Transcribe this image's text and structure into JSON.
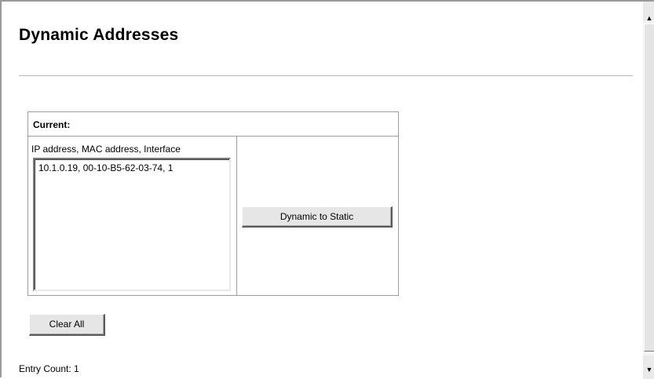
{
  "page": {
    "title": "Dynamic Addresses"
  },
  "current": {
    "header": "Current:",
    "list_label": "IP address, MAC address, Interface",
    "entries": [
      "10.1.0.19, 00-10-B5-62-03-74, 1"
    ],
    "dynamic_to_static_label": "Dynamic to Static"
  },
  "actions": {
    "clear_all_label": "Clear All"
  },
  "footer": {
    "entry_count": "Entry Count: 1"
  },
  "scrollbar": {
    "up_icon": "arrow-up-icon",
    "down_icon": "arrow-down-icon"
  }
}
